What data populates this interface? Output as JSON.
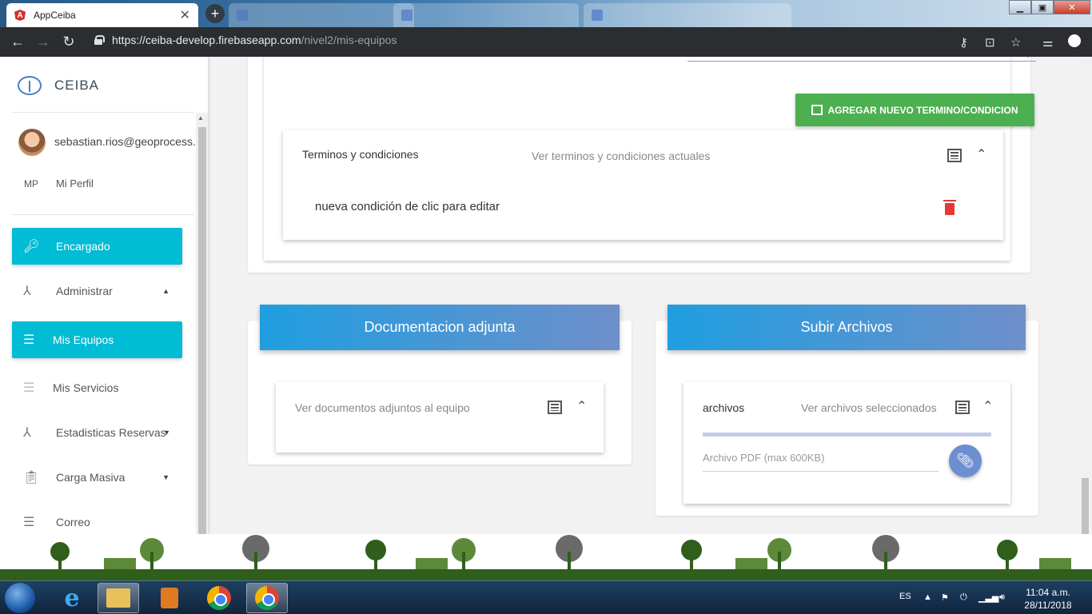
{
  "browser": {
    "active_tab_title": "AppCeiba",
    "url_host": "https://ceiba-develop.firebaseapp.com",
    "url_path": "/nivel2/mis-equipos"
  },
  "sidebar": {
    "brand": "CEIBA",
    "user_email": "sebastian.rios@geoprocess.c",
    "profile_initials": "MP",
    "profile_label": "Mi Perfil",
    "items": [
      {
        "label": "Encargado",
        "icon": "key-icon",
        "active": true
      },
      {
        "label": "Administrar",
        "icon": "hierarchy-icon",
        "active": false
      },
      {
        "label": "Mis Equipos",
        "icon": "list-icon",
        "active": true
      },
      {
        "label": "Mis Servicios",
        "icon": "list-icon",
        "active": false
      },
      {
        "label": "Estadisticas Reservas",
        "icon": "hierarchy-icon",
        "active": false
      },
      {
        "label": "Carga Masiva",
        "icon": "clipboard-icon",
        "active": false
      },
      {
        "label": "Correo",
        "icon": "list-icon",
        "active": false
      }
    ]
  },
  "terms": {
    "add_button": "AGREGAR NUEVO TERMINO/CONDICION",
    "panel_title": "Terminos y condiciones",
    "panel_desc": "Ver terminos y condiciones actuales",
    "item": "nueva condición de clic para editar"
  },
  "documentation": {
    "header": "Documentacion adjunta",
    "panel_desc": "Ver documentos adjuntos al equipo"
  },
  "upload": {
    "header": "Subir Archivos",
    "panel_title": "archivos",
    "panel_desc": "Ver archivos seleccionados",
    "input_placeholder": "Archivo PDF (max 600KB)"
  },
  "taskbar": {
    "language": "ES",
    "time": "11:04 a.m.",
    "date": "28/11/2018"
  },
  "colors": {
    "accent_cyan": "#00bcd4",
    "green_button": "#4caf50",
    "header_gradient_start": "#1f9ee0",
    "header_gradient_end": "#6e8fca",
    "delete_red": "#e53935"
  }
}
